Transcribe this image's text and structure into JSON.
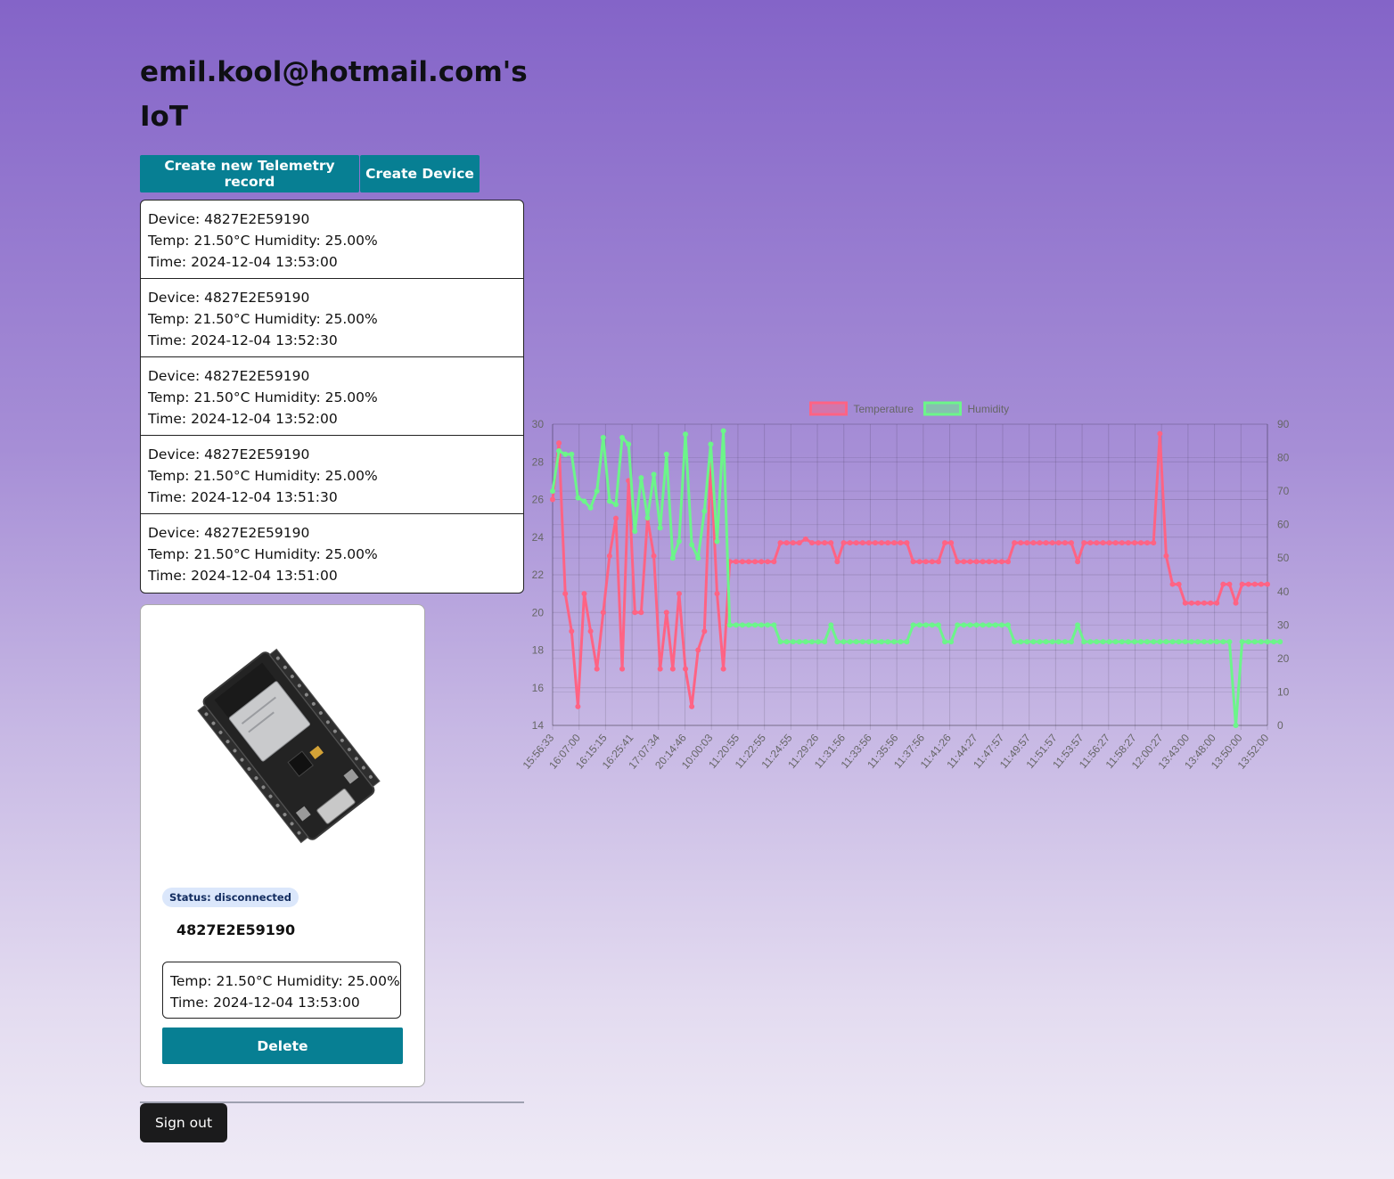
{
  "header": {
    "title": "emil.kool@hotmail.com's IoT"
  },
  "toolbar": {
    "create_telemetry_label": "Create new Telemetry record",
    "create_device_label": "Create Device"
  },
  "telemetry": [
    {
      "device": "Device: 4827E2E59190",
      "reading": "Temp: 21.50°C Humidity: 25.00%",
      "time": "Time: 2024-12-04 13:53:00"
    },
    {
      "device": "Device: 4827E2E59190",
      "reading": "Temp: 21.50°C Humidity: 25.00%",
      "time": "Time: 2024-12-04 13:52:30"
    },
    {
      "device": "Device: 4827E2E59190",
      "reading": "Temp: 21.50°C Humidity: 25.00%",
      "time": "Time: 2024-12-04 13:52:00"
    },
    {
      "device": "Device: 4827E2E59190",
      "reading": "Temp: 21.50°C Humidity: 25.00%",
      "time": "Time: 2024-12-04 13:51:30"
    },
    {
      "device": "Device: 4827E2E59190",
      "reading": "Temp: 21.50°C Humidity: 25.00%",
      "time": "Time: 2024-12-04 13:51:00"
    }
  ],
  "device_card": {
    "status": "Status: disconnected",
    "name": "4827E2E59190",
    "latest_reading": "Temp: 21.50°C Humidity: 25.00%",
    "latest_time": "Time: 2024-12-04 13:53:00",
    "delete_label": "Delete",
    "image_icon": "esp32-board-image"
  },
  "footer": {
    "signout_label": "Sign out"
  },
  "colors": {
    "primary_button": "#077f93",
    "temperature": "#ff6384",
    "humidity": "#6cf58a",
    "signout": "#1b1b1c"
  },
  "chart_data": {
    "type": "line",
    "x": [
      "15:56:33",
      "16:07:00",
      "16:15:15",
      "16:25:41",
      "17:07:34",
      "20:14:46",
      "10:00:03",
      "11:20:55",
      "11:22:55",
      "11:24:55",
      "11:29:26",
      "11:31:56",
      "11:33:56",
      "11:35:56",
      "11:37:56",
      "11:41:26",
      "11:44:27",
      "11:47:57",
      "11:49:57",
      "11:51:57",
      "11:53:57",
      "11:56:27",
      "11:58:27",
      "12:00:27",
      "13:43:00",
      "13:48:00",
      "13:50:00",
      "13:52:00"
    ],
    "series": [
      {
        "name": "Temperature",
        "axis": "left",
        "color": "#ff6384",
        "values": [
          26,
          29,
          21,
          19,
          15,
          21,
          19,
          17,
          20,
          23,
          25,
          17,
          27,
          20,
          20,
          25,
          23,
          17,
          20,
          17,
          21,
          17,
          15,
          18,
          19,
          28,
          21,
          17,
          22.7,
          22.7,
          22.7,
          22.7,
          22.7,
          22.7,
          22.7,
          22.7,
          23.7,
          23.7,
          23.7,
          23.7,
          23.9,
          23.7,
          23.7,
          23.7,
          23.7,
          22.7,
          23.7,
          23.7,
          23.7,
          23.7,
          23.7,
          23.7,
          23.7,
          23.7,
          23.7,
          23.7,
          23.7,
          22.7,
          22.7,
          22.7,
          22.7,
          22.7,
          23.7,
          23.7,
          22.7,
          22.7,
          22.7,
          22.7,
          22.7,
          22.7,
          22.7,
          22.7,
          22.7,
          23.7,
          23.7,
          23.7,
          23.7,
          23.7,
          23.7,
          23.7,
          23.7,
          23.7,
          23.7,
          22.7,
          23.7,
          23.7,
          23.7,
          23.7,
          23.7,
          23.7,
          23.7,
          23.7,
          23.7,
          23.7,
          23.7,
          23.7,
          29.5,
          23,
          21.5,
          21.5,
          20.5,
          20.5,
          20.5,
          20.5,
          20.5,
          20.5,
          21.5,
          21.5,
          20.5,
          21.5,
          21.5,
          21.5,
          21.5,
          21.5
        ]
      },
      {
        "name": "Humidity",
        "axis": "right",
        "color": "#6cf58a",
        "values": [
          70,
          82,
          81,
          81,
          68,
          67,
          65,
          70,
          86,
          67,
          66,
          86,
          84,
          58,
          74,
          62,
          75,
          59,
          81,
          50,
          55,
          87,
          54,
          50,
          64,
          84,
          55,
          88,
          30,
          30,
          30,
          30,
          30,
          30,
          30,
          30,
          25,
          25,
          25,
          25,
          25,
          25,
          25,
          25,
          30,
          25,
          25,
          25,
          25,
          25,
          25,
          25,
          25,
          25,
          25,
          25,
          25,
          30,
          30,
          30,
          30,
          30,
          25,
          25,
          30,
          30,
          30,
          30,
          30,
          30,
          30,
          30,
          30,
          25,
          25,
          25,
          25,
          25,
          25,
          25,
          25,
          25,
          25,
          30,
          25,
          25,
          25,
          25,
          25,
          25,
          25,
          25,
          25,
          25,
          25,
          25,
          25,
          25,
          25,
          25,
          25,
          25,
          25,
          25,
          25,
          25,
          25,
          25,
          0,
          25,
          25,
          25,
          25,
          25,
          25,
          25
        ]
      }
    ],
    "y_left": {
      "range": [
        14,
        30
      ],
      "ticks": [
        14,
        16,
        18,
        20,
        22,
        24,
        26,
        28,
        30
      ]
    },
    "y_right": {
      "range": [
        0,
        90
      ],
      "ticks": [
        0,
        10,
        20,
        30,
        40,
        50,
        60,
        70,
        80,
        90
      ]
    },
    "grid": true,
    "legend": "top-center"
  }
}
